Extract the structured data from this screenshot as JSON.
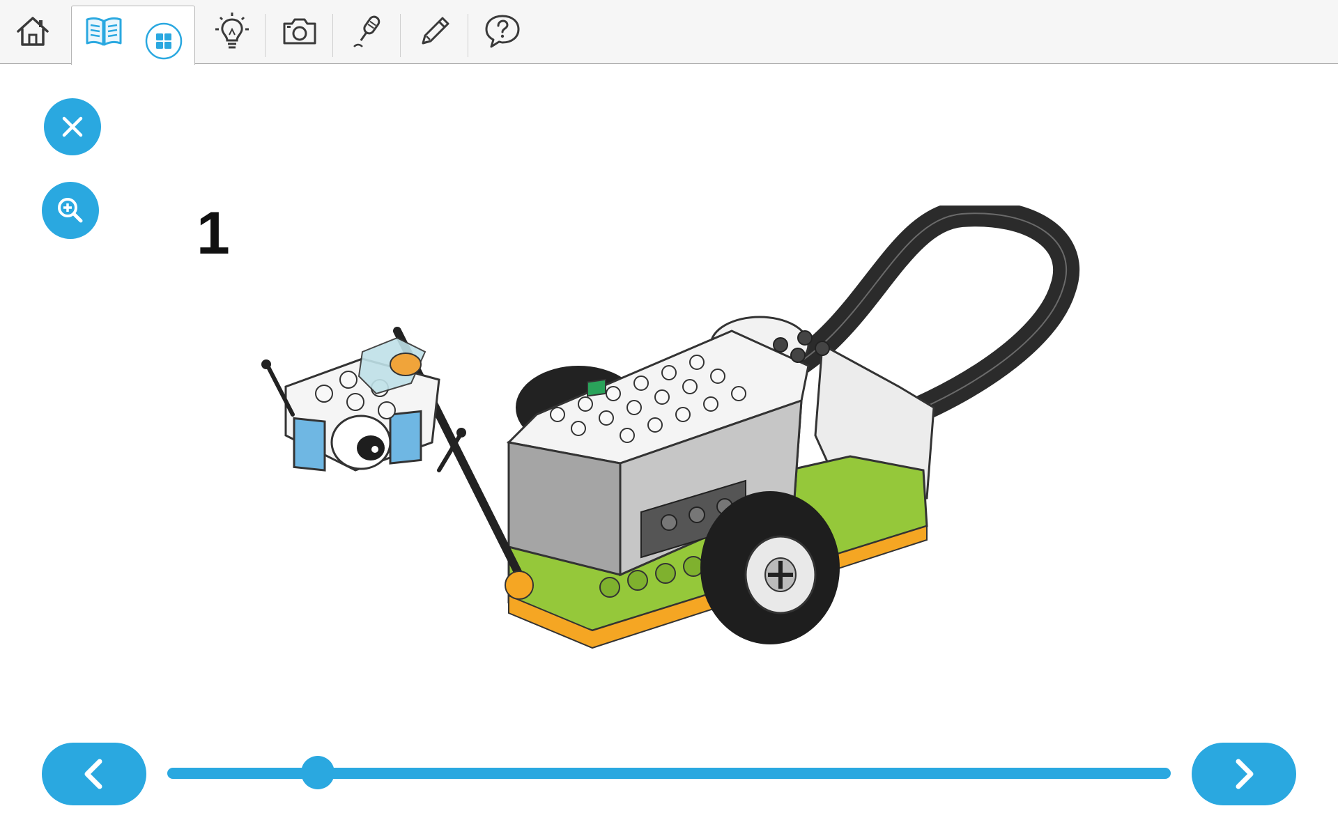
{
  "toolbar": {
    "items": [
      {
        "name": "home",
        "icon": "home-icon"
      },
      {
        "name": "build-instructions",
        "icon": "book-icon",
        "active": true
      },
      {
        "name": "grid-view",
        "icon": "grid-icon"
      },
      {
        "name": "explore",
        "icon": "lightbulb-icon"
      },
      {
        "name": "camera",
        "icon": "camera-icon"
      },
      {
        "name": "record",
        "icon": "microphone-icon"
      },
      {
        "name": "notes",
        "icon": "pencil-icon"
      },
      {
        "name": "help",
        "icon": "help-bubble-icon"
      }
    ]
  },
  "controls": {
    "close_icon": "close-icon",
    "zoom_icon": "zoom-in-icon"
  },
  "step": {
    "number": "1"
  },
  "navigation": {
    "prev_icon": "chevron-left-icon",
    "next_icon": "chevron-right-icon",
    "progress": 0.15
  },
  "colors": {
    "accent": "#2aa8e0",
    "icon_dark": "#3a3a3a",
    "lego_green": "#95c83a",
    "lego_orange": "#f5a623",
    "lego_blue": "#6fb7e3"
  }
}
